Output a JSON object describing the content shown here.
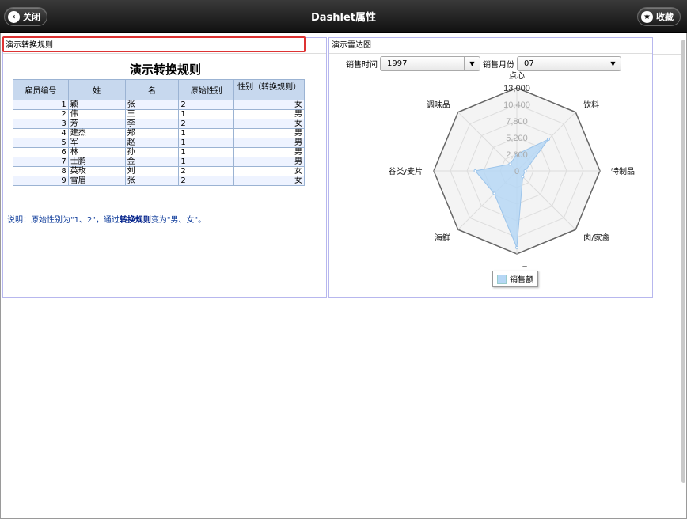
{
  "header": {
    "title": "Dashlet属性",
    "close_label": "关闭",
    "fav_label": "收藏"
  },
  "left_panel": {
    "tab_label": "演示转换规则",
    "table_title": "演示转换规则",
    "columns": [
      "雇员编号",
      "姓",
      "名",
      "原始性别",
      "性别（转换规则）"
    ],
    "rows": [
      [
        "1",
        "颖",
        "张",
        "2",
        "女"
      ],
      [
        "2",
        "伟",
        "王",
        "1",
        "男"
      ],
      [
        "3",
        "芳",
        "李",
        "2",
        "女"
      ],
      [
        "4",
        "建杰",
        "郑",
        "1",
        "男"
      ],
      [
        "5",
        "军",
        "赵",
        "1",
        "男"
      ],
      [
        "6",
        "林",
        "孙",
        "1",
        "男"
      ],
      [
        "7",
        "士鹏",
        "金",
        "1",
        "男"
      ],
      [
        "8",
        "英玫",
        "刘",
        "2",
        "女"
      ],
      [
        "9",
        "雪眉",
        "张",
        "2",
        "女"
      ]
    ],
    "desc_prefix": "说明：原始性别为\"1、2\"，通过",
    "desc_bold": "转换规则",
    "desc_suffix": "变为\"男、女\"。"
  },
  "right_panel": {
    "tab_label": "演示雷达图",
    "year_label": "销售时间",
    "year_value": "1997",
    "month_label": "销售月份",
    "month_value": "07"
  },
  "chart_data": {
    "type": "radar",
    "categories": [
      "点心",
      "饮料",
      "特制品",
      "肉/家禽",
      "日用品",
      "海鲜",
      "谷类/麦片",
      "调味品"
    ],
    "series": [
      {
        "name": "销售额",
        "values": [
          2600,
          7000,
          1300,
          1300,
          12000,
          5000,
          6500,
          1500
        ]
      }
    ],
    "rlim": [
      0,
      13000
    ],
    "ticks": [
      "0",
      "2,600",
      "5,200",
      "7,800",
      "10,400",
      "13,000"
    ],
    "color": "#b6d7f5",
    "legend": "bottom"
  }
}
